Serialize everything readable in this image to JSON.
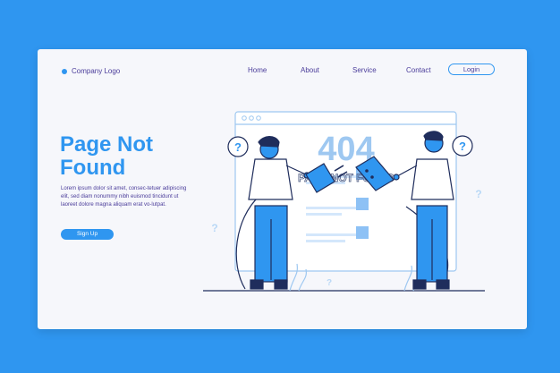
{
  "header": {
    "logo_text": "Company Logo",
    "nav": [
      "Home",
      "About",
      "Service",
      "Contact"
    ],
    "login_label": "Login"
  },
  "hero": {
    "title_line1": "Page Not",
    "title_line2": "Found",
    "description": "Lorem ipsum dolor sit amet, consec-tetuer adipiscing elit, sed diam nonummy nibh euismod tincidunt ut laoreet dolore magna aliquam erat vo-lutpat.",
    "signup_label": "Sign Up"
  },
  "illustration": {
    "code": "404",
    "subtitle": "PAGE NOT FOUND",
    "question_mark": "?"
  },
  "colors": {
    "background": "#2f96f0",
    "card": "#f6f7fb",
    "accent": "#2f96f0",
    "text": "#4a3c9a",
    "outline": "#1f2d5c"
  }
}
